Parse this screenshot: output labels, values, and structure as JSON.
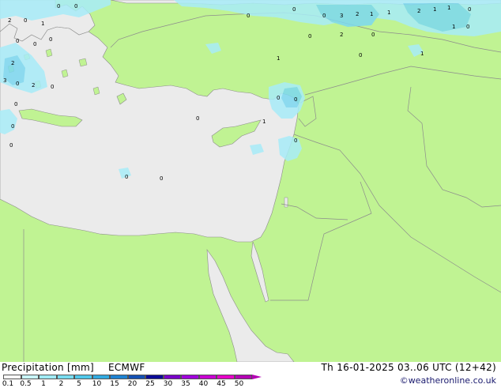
{
  "header": {
    "title": "Precipitation [mm]",
    "model": "ECMWF",
    "datetime": "Th 16-01-2025 03..06 UTC (12+42)",
    "credit": "©weatheronline.co.uk"
  },
  "legend": {
    "ticks": [
      "0.1",
      "0.5",
      "1",
      "2",
      "5",
      "10",
      "15",
      "20",
      "25",
      "30",
      "35",
      "40",
      "45",
      "50"
    ],
    "colors": [
      "#fafafa",
      "#c8f5fa",
      "#a0ebf5",
      "#78dcf0",
      "#50c8eb",
      "#32aae1",
      "#1e82d2",
      "#1450b4",
      "#0a0a96",
      "#7800c8",
      "#a000dc",
      "#c800d2",
      "#e600c8",
      "#b400b4"
    ]
  },
  "colors": {
    "sea": "#ebebeb",
    "land": "#c0f393",
    "border": "#8c8c8c",
    "precip_light": "#a8ecf8",
    "precip_mid": "#7cd8f0"
  },
  "map_labels": [
    "0",
    "2",
    "0",
    "0",
    "1",
    "0",
    "0",
    "0",
    "3",
    "2",
    "1",
    "0",
    "1",
    "2",
    "1",
    "1",
    "0",
    "0",
    "2",
    "0",
    "0",
    "1",
    "0",
    "1",
    "1",
    "2",
    "0",
    "2",
    "3",
    "0",
    "0",
    "0",
    "0",
    "0",
    "1",
    "0",
    "0",
    "0",
    "0",
    "0",
    "0",
    "0"
  ]
}
